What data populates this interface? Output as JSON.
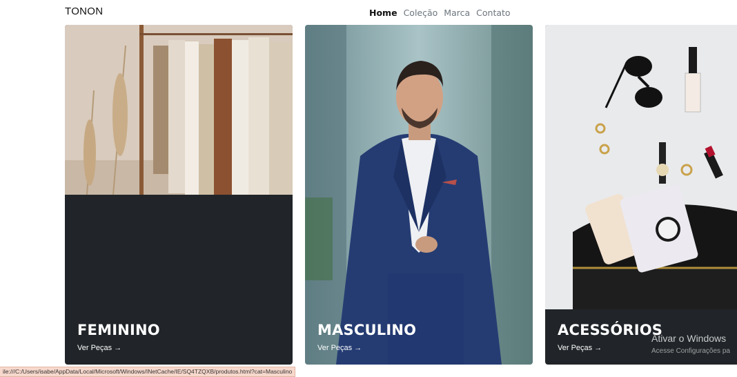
{
  "brand": "TONON",
  "nav": {
    "items": [
      {
        "label": "Home",
        "active": true
      },
      {
        "label": "Coleção"
      },
      {
        "label": "Marca"
      },
      {
        "label": "Contato"
      }
    ]
  },
  "cards": [
    {
      "title": "FEMININO",
      "link": "Ver Peças →"
    },
    {
      "title": "MASCULINO",
      "link": "Ver Peças →"
    },
    {
      "title": "ACESSÓRIOS",
      "link": "Ver Peças →"
    }
  ],
  "watermark": {
    "line1": "Ativar o Windows",
    "line2": "Acesse Configurações pa"
  },
  "status_url": "ile:///C:/Users/isabe/AppData/Local/Microsoft/Windows/INetCache/IE/SQ4TZQXB/produtos.html?cat=Masculino",
  "colors": {
    "card_dark": "#212529",
    "nav_muted": "#6c757d",
    "status_bg": "#f7d8cc"
  }
}
